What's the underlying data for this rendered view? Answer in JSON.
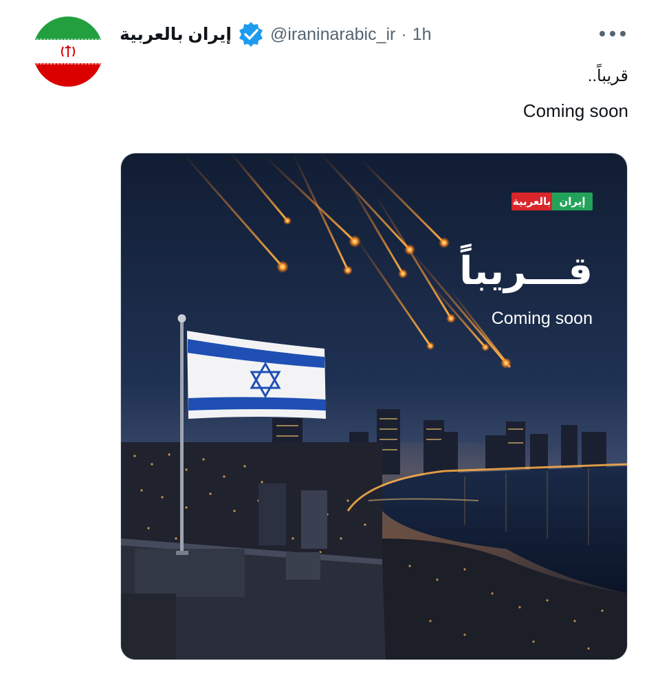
{
  "tweet": {
    "display_name": "إيران بالعربية",
    "handle": "@iraninarabic_ir",
    "separator": "·",
    "time": "1h",
    "text_arabic": "قريباً..",
    "text_english": "Coming soon"
  },
  "media": {
    "brand_green": "إيران",
    "brand_red": "بالعربية",
    "headline_arabic": "قـــريباً",
    "headline_english": "Coming soon"
  },
  "icons": {
    "avatar": "iran-flag-avatar",
    "verified": "verified-badge-icon",
    "more": "more-options-icon"
  },
  "colors": {
    "verified_blue": "#1d9bf0",
    "brand_green": "#23a35a",
    "brand_red": "#d8262b",
    "flag_blue": "#1f4fb3"
  }
}
